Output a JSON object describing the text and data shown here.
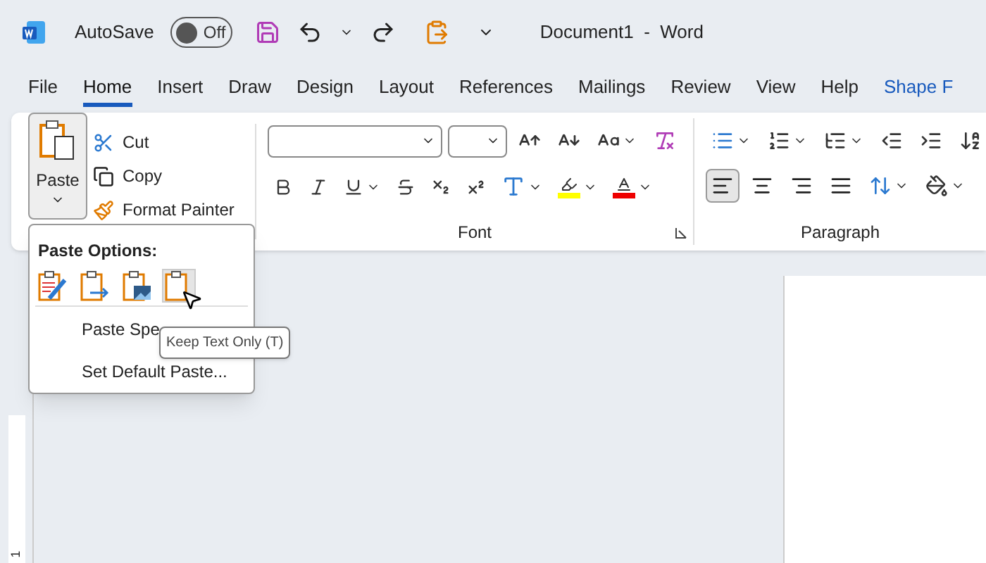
{
  "title_bar": {
    "autosave_label": "AutoSave",
    "autosave_toggle": {
      "on": false,
      "label": "Off"
    },
    "document_title": "Document1  -  Word"
  },
  "tabs": [
    {
      "label": "File",
      "selected": false
    },
    {
      "label": "Home",
      "selected": true
    },
    {
      "label": "Insert",
      "selected": false
    },
    {
      "label": "Draw",
      "selected": false
    },
    {
      "label": "Design",
      "selected": false
    },
    {
      "label": "Layout",
      "selected": false
    },
    {
      "label": "References",
      "selected": false
    },
    {
      "label": "Mailings",
      "selected": false
    },
    {
      "label": "Review",
      "selected": false
    },
    {
      "label": "View",
      "selected": false
    },
    {
      "label": "Help",
      "selected": false
    },
    {
      "label": "Shape F",
      "selected": false
    }
  ],
  "ribbon": {
    "clipboard": {
      "paste": {
        "label": "Paste",
        "expanded": true
      },
      "commands": [
        {
          "kind": "cut",
          "label": "Cut"
        },
        {
          "kind": "copy",
          "label": "Copy"
        },
        {
          "kind": "painter",
          "label": "Format Painter"
        }
      ]
    },
    "font": {
      "label": "Font"
    },
    "paragraph": {
      "label": "Paragraph",
      "alignments": [
        {
          "kind": "left",
          "selected": true
        },
        {
          "kind": "center",
          "selected": false
        },
        {
          "kind": "right",
          "selected": false
        },
        {
          "kind": "justify",
          "selected": false
        }
      ]
    }
  },
  "paste_menu": {
    "heading": "Paste Options:",
    "options": [
      {
        "kind": "keep-source",
        "selected": false
      },
      {
        "kind": "merge",
        "selected": false
      },
      {
        "kind": "picture",
        "selected": false
      },
      {
        "kind": "text-only",
        "selected": true
      }
    ],
    "items": [
      "Paste Spe",
      "Set Default Paste..."
    ]
  },
  "tooltip": "Keep Text Only (T)",
  "vertical_ruler": {
    "label": "1"
  }
}
